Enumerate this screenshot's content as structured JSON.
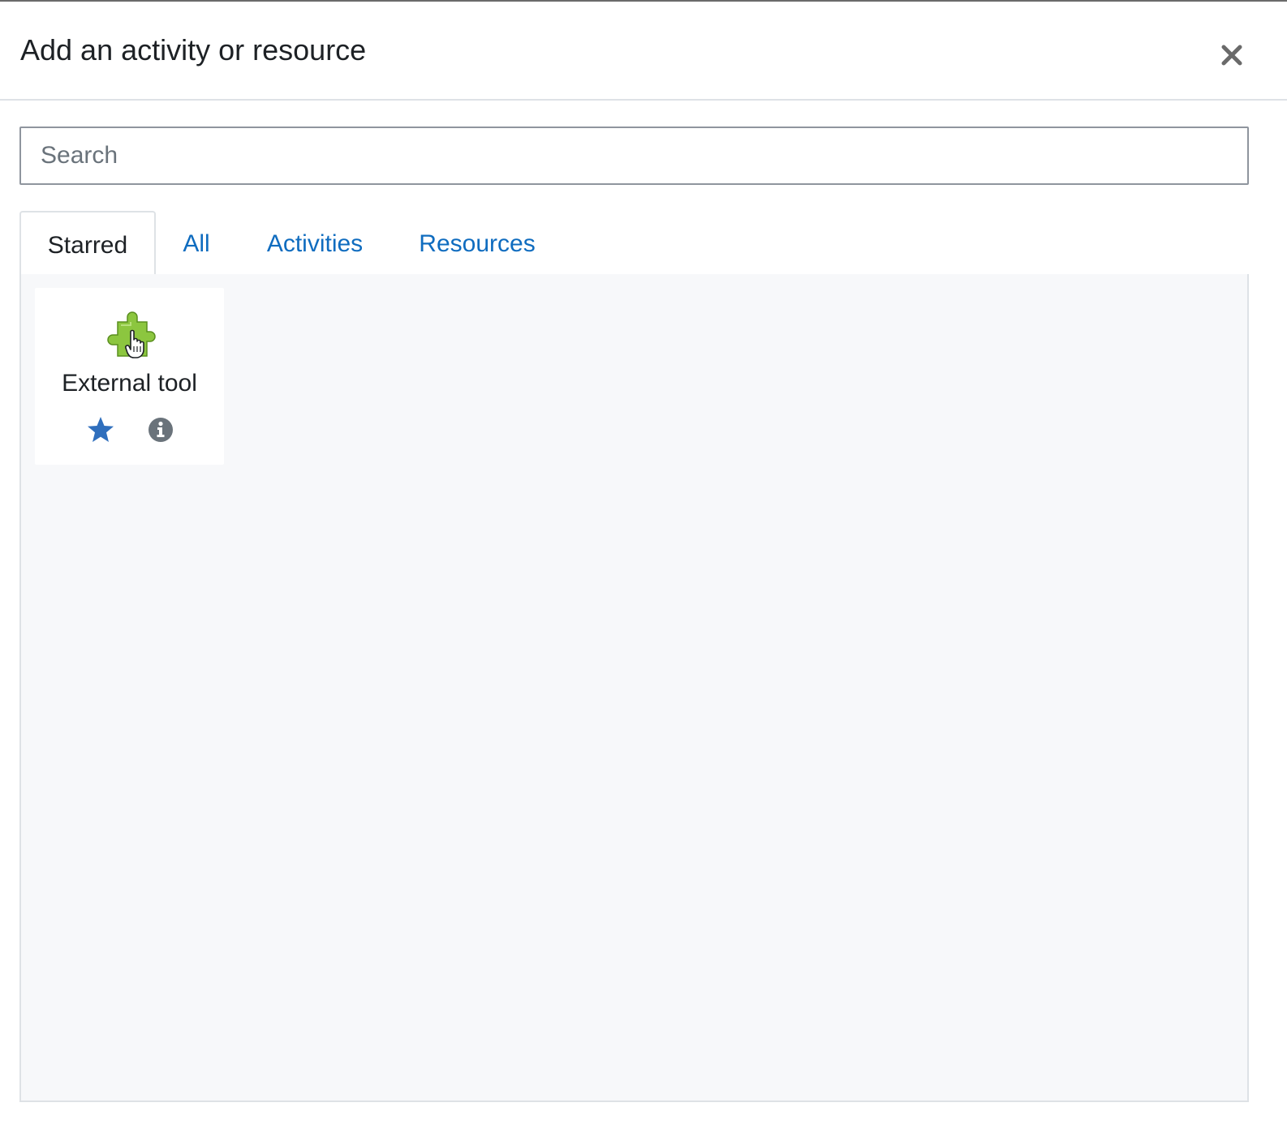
{
  "modal": {
    "title": "Add an activity or resource",
    "close_label": "×"
  },
  "search": {
    "placeholder": "Search",
    "value": ""
  },
  "tabs": [
    {
      "label": "Starred",
      "active": true
    },
    {
      "label": "All",
      "active": false
    },
    {
      "label": "Activities",
      "active": false
    },
    {
      "label": "Resources",
      "active": false
    }
  ],
  "items": [
    {
      "name": "External tool",
      "icon": "puzzle-piece-icon",
      "starred": true
    }
  ],
  "colors": {
    "accent": "#0f6cbf",
    "star": "#2f6fbd",
    "info": "#6a737b",
    "puzzle": "#8cc63f",
    "panel_bg": "#f7f8fa"
  }
}
